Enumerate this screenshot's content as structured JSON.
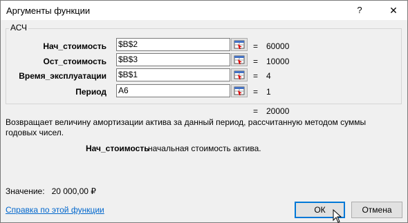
{
  "window": {
    "title": "Аргументы функции",
    "help": "?",
    "close": "✕"
  },
  "function_name": "АСЧ",
  "arguments": [
    {
      "label": "Нач_стоимость",
      "value": "$B$2",
      "result": "60000"
    },
    {
      "label": "Ост_стоимость",
      "value": "$B$3",
      "result": "10000"
    },
    {
      "label": "Время_эксплуатации",
      "value": "$B$1",
      "result": "4"
    },
    {
      "label": "Период",
      "value": "A6",
      "result": "1"
    }
  ],
  "equals": "=",
  "formula_result": "20000",
  "description": "Возвращает величину амортизации актива за данный период, рассчитанную методом суммы годовых чисел.",
  "argument_help": {
    "name": "Нач_стоимость",
    "text": "начальная стоимость актива."
  },
  "result": {
    "label": "Значение:",
    "value": "20 000,00 ₽"
  },
  "help_link": "Справка по этой функции",
  "buttons": {
    "ok": "ОК",
    "cancel": "Отмена"
  },
  "icons": {
    "range_selector": "collapse-dialog-icon",
    "cursor": "mouse-pointer-icon"
  }
}
